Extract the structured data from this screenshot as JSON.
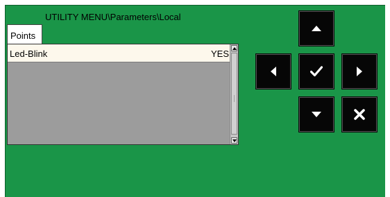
{
  "window": {
    "title": "UTILITY MENU\\Parameters\\Local"
  },
  "tabs": [
    {
      "label": "Points",
      "active": true
    }
  ],
  "list": {
    "rows": [
      {
        "name": "Led-Blink",
        "value": "YES",
        "selected": true
      }
    ]
  },
  "nav_buttons": {
    "up": "arrow-up-icon",
    "down": "arrow-down-icon",
    "left": "arrow-left-icon",
    "right": "arrow-right-icon",
    "ok": "checkmark-icon",
    "cancel": "cross-icon"
  },
  "colors": {
    "background": "#1a9548",
    "button": "#060606",
    "list_background": "#9c9c9c",
    "row_selected": "#fdf8ec"
  }
}
